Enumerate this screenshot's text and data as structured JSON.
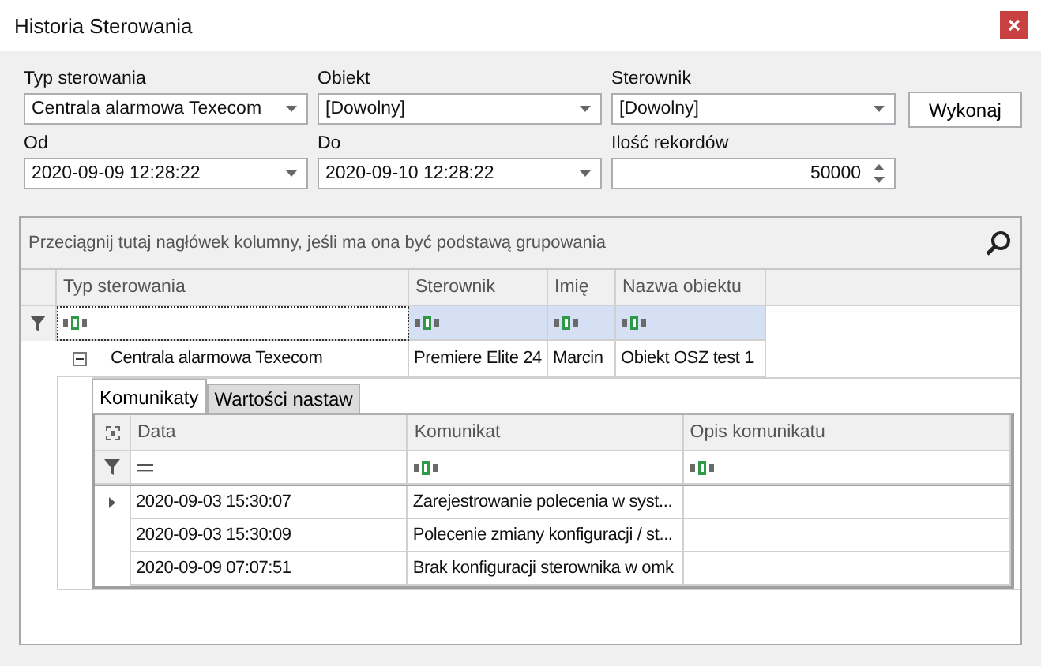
{
  "window": {
    "title": "Historia Sterowania"
  },
  "filters": [
    {
      "label": "Typ sterowania",
      "value": "Centrala alarmowa Texecom",
      "kind": "dropdown"
    },
    {
      "label": "Obiekt",
      "value": "[Dowolny]",
      "kind": "dropdown"
    },
    {
      "label": "Sterownik",
      "value": "[Dowolny]",
      "kind": "dropdown"
    },
    {
      "label": "Od",
      "value": "2020-09-09 12:28:22",
      "kind": "dropdown"
    },
    {
      "label": "Do",
      "value": "2020-09-10 12:28:22",
      "kind": "dropdown"
    },
    {
      "label": "Ilość rekordów",
      "value": "50000",
      "kind": "spin"
    }
  ],
  "execute_button": "Wykonaj",
  "grid": {
    "group_panel_hint": "Przeciągnij tutaj nagłówek kolumny, jeśli ma ona być podstawą grupowania",
    "columns": [
      "Typ sterowania",
      "Sterownik",
      "Imię",
      "Nazwa obiektu"
    ],
    "filter_row": [
      {
        "kind": "text",
        "focused": true
      },
      {
        "kind": "text",
        "focused": false
      },
      {
        "kind": "text",
        "focused": false
      },
      {
        "kind": "text",
        "focused": false
      }
    ],
    "rows": [
      {
        "expanded": true,
        "cells": [
          "Centrala alarmowa Texecom",
          "Premiere Elite 24",
          "Marcin",
          "Obiekt OSZ test 1"
        ],
        "detail": {
          "tabs": [
            {
              "label": "Komunikaty",
              "selected": true
            },
            {
              "label": "Wartości nastaw",
              "selected": false
            }
          ],
          "columns": [
            "Data",
            "Komunikat",
            "Opis komunikatu"
          ],
          "filter_row": [
            {
              "kind": "equals"
            },
            {
              "kind": "text"
            },
            {
              "kind": "text"
            }
          ],
          "rows": [
            {
              "current": true,
              "cells": [
                "2020-09-03 15:30:07",
                "Zarejestrowanie polecenia w syst...",
                ""
              ]
            },
            {
              "current": false,
              "cells": [
                "2020-09-03 15:30:09",
                "Polecenie zmiany konfiguracji / st...",
                ""
              ]
            },
            {
              "current": false,
              "cells": [
                "2020-09-09 07:07:51",
                "Brak konfiguracji sterownika w omk",
                ""
              ]
            }
          ]
        }
      }
    ]
  }
}
